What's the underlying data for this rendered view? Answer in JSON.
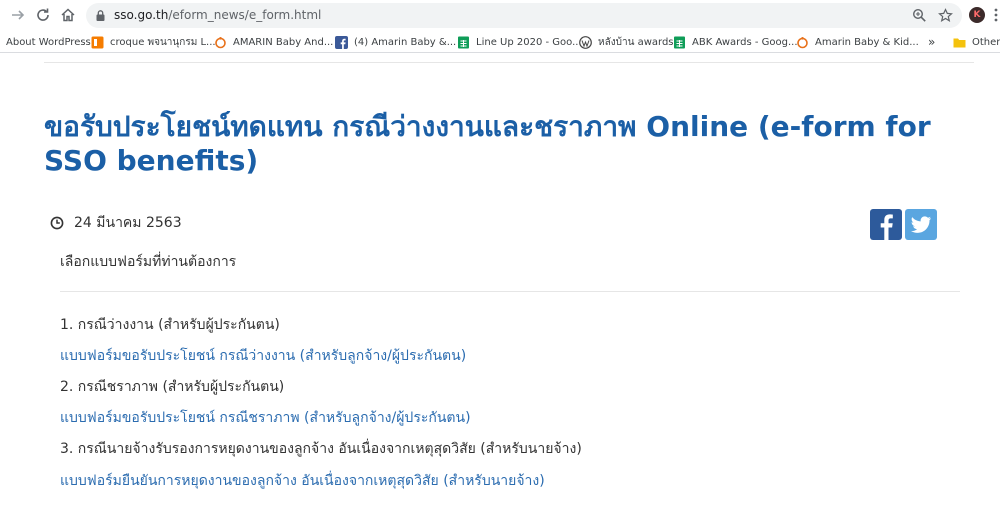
{
  "browser": {
    "url_host": "sso.go.th",
    "url_path": "/eform_news/e_form.html",
    "profile_initial": "K"
  },
  "bookmarks": [
    {
      "label": "About WordPress",
      "icon": "none"
    },
    {
      "label": "croque  พจนานุกรม L...",
      "icon": "dictionary-icon",
      "color": "#f57c00"
    },
    {
      "label": "AMARIN Baby And...",
      "icon": "amarin-icon",
      "color": "#e8711a"
    },
    {
      "label": "(4) Amarin Baby &...",
      "icon": "facebook-icon",
      "color": "#3b5998"
    },
    {
      "label": "Line Up 2020 - Goo...",
      "icon": "sheets-icon",
      "color": "#0f9d58"
    },
    {
      "label": "หลังบ้าน awards",
      "icon": "wordpress-icon",
      "color": "#464646"
    },
    {
      "label": "ABK Awards - Goog...",
      "icon": "sheets-icon",
      "color": "#0f9d58"
    },
    {
      "label": "Amarin Baby & Kid...",
      "icon": "amarin-icon",
      "color": "#e8711a"
    },
    {
      "label": "»",
      "icon": "none"
    },
    {
      "label": "Other b",
      "icon": "folder-icon",
      "color": "#f4c20d"
    }
  ],
  "page": {
    "title": "ขอรับประโยชน์ทดแทน กรณีว่างงานและชราภาพ Online (e-form for SSO benefits)",
    "date": "24 มีนาคม 2563",
    "intro": "เลือกแบบฟอร์มที่ท่านต้องการ",
    "items": [
      {
        "heading": "1. กรณีว่างงาน (สำหรับผู้ประกันตน)",
        "link": "แบบฟอร์มขอรับประโยชน์ กรณีว่างงาน (สำหรับลูกจ้าง/ผู้ประกันตน)"
      },
      {
        "heading": "2. กรณีชราภาพ (สำหรับผู้ประกันตน)",
        "link": "แบบฟอร์มขอรับประโยชน์ กรณีชราภาพ (สำหรับลูกจ้าง/ผู้ประกันตน)"
      },
      {
        "heading": "3. กรณีนายจ้างรับรองการหยุดงานของลูกจ้าง อันเนื่องจากเหตุสุดวิสัย (สำหรับนายจ้าง)",
        "link": "แบบฟอร์มยืนยันการหยุดงานของลูกจ้าง อันเนื่องจากเหตุสุดวิสัย (สำหรับนายจ้าง)"
      }
    ]
  },
  "colors": {
    "title": "#1b5fa6",
    "link": "#2b6cb0",
    "facebook": "#2d5a9b",
    "twitter": "#5aa6e0"
  }
}
